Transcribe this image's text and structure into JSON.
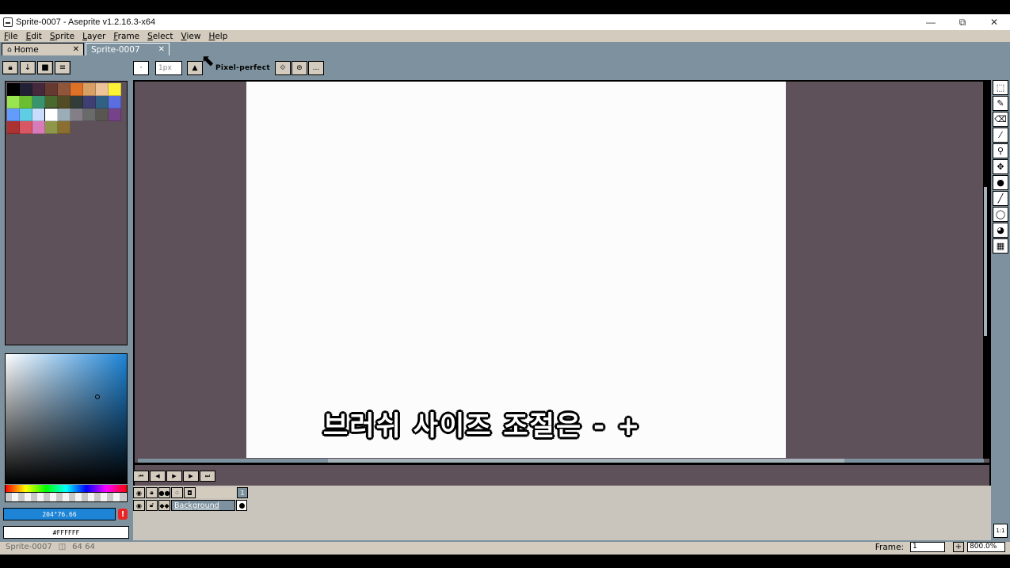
{
  "window": {
    "title": "Sprite-0007 - Aseprite v1.2.16.3-x64",
    "controls": [
      "—",
      "⧉",
      "✕"
    ]
  },
  "menu": [
    "File",
    "Edit",
    "Sprite",
    "Layer",
    "Frame",
    "Select",
    "View",
    "Help"
  ],
  "tabs": [
    {
      "label": "Home",
      "icon": "home-icon",
      "close": "✕"
    },
    {
      "label": "Sprite-0007",
      "close": "✕"
    }
  ],
  "colorbar": {
    "tools": [
      "lock-icon",
      "arrow-down-icon",
      "square-icon",
      "menu-icon"
    ],
    "palette": [
      "#000000",
      "#222034",
      "#45283c",
      "#663931",
      "#8f563b",
      "#df7126",
      "#d9a066",
      "#eec39a",
      "#fbf236",
      "#99e550",
      "#6abe30",
      "#37946e",
      "#4b692f",
      "#524b24",
      "#323c39",
      "#3f3f74",
      "#306082",
      "#5b6ee1",
      "#639bff",
      "#5fcde4",
      "#cbdbfc",
      "#ffffff",
      "#9badb7",
      "#847e87",
      "#696a6a",
      "#595652",
      "#76428a",
      "#ac3232",
      "#d95763",
      "#d77bba",
      "#8f974a",
      "#8a6f30"
    ],
    "hsv_value": "204°76.66",
    "hex_value": "#FFFFFF",
    "warning": "!"
  },
  "context": {
    "brush_size": "1px",
    "pixel_perfect": "Pixel-perfect",
    "more": "..."
  },
  "tools": [
    "marquee-icon",
    "pencil-icon",
    "eraser-icon",
    "eyedropper-icon",
    "zoom-icon",
    "move-icon",
    "fill-icon",
    "line-icon",
    "ellipse-icon",
    "blur-icon",
    "spray-icon"
  ],
  "timeline": {
    "controls": [
      "⏮",
      "◀",
      "▶",
      "▶",
      "⏭"
    ],
    "frame_number": "1",
    "layer_name": "Background"
  },
  "subtitle": "브러쉬 사이즈 조절은 - +",
  "status": {
    "sprite_name": "Sprite-0007",
    "dims": "64 64",
    "frame_label": "Frame:",
    "frame_value": "1",
    "zoom_value": "800.0%"
  },
  "colors": {
    "panel": "#7d929e",
    "menu": "#d3cbbe",
    "editor_bg": "#5f515a",
    "canvas": "#fcfcfc",
    "accent": "#1d84d6"
  }
}
